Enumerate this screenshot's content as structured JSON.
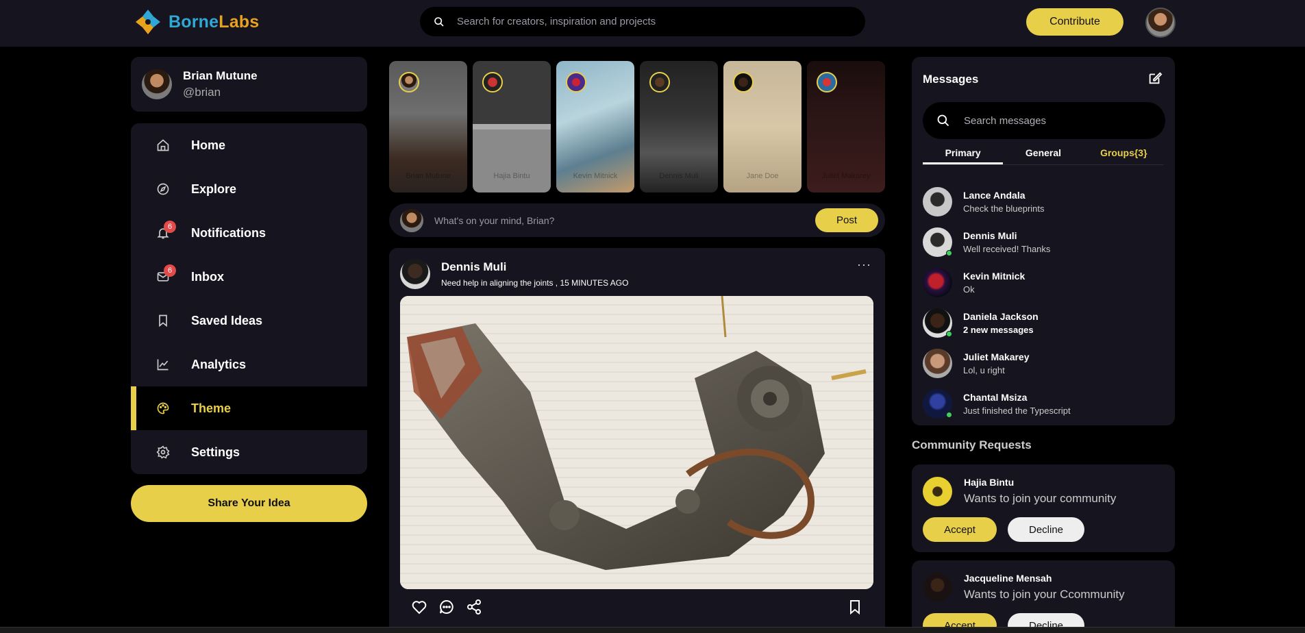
{
  "brand": {
    "part1": "Borne",
    "part2": "Labs"
  },
  "search": {
    "placeholder": "Search for creators, inspiration and projects"
  },
  "header": {
    "contribute_label": "Contribute"
  },
  "profile": {
    "name": "Brian Mutune",
    "handle": "@brian"
  },
  "nav": {
    "items": [
      {
        "label": "Home",
        "icon": "home-icon"
      },
      {
        "label": "Explore",
        "icon": "compass-icon"
      },
      {
        "label": "Notifications",
        "icon": "bell-icon",
        "badge": "6"
      },
      {
        "label": "Inbox",
        "icon": "mail-icon",
        "badge": "6"
      },
      {
        "label": "Saved Ideas",
        "icon": "bookmark-icon"
      },
      {
        "label": "Analytics",
        "icon": "chart-icon"
      },
      {
        "label": "Theme",
        "icon": "palette-icon",
        "active": true
      },
      {
        "label": "Settings",
        "icon": "gear-icon"
      }
    ],
    "share_label": "Share Your Idea"
  },
  "stories": [
    {
      "label": "Brian Mutune"
    },
    {
      "label": "Hajia Bintu"
    },
    {
      "label": "Kevin Mitnick"
    },
    {
      "label": "Dennis Muli"
    },
    {
      "label": "Jane Doe"
    },
    {
      "label": "Juliet Makarey"
    }
  ],
  "compose": {
    "placeholder": "What's on your mind, Brian?",
    "post_label": "Post"
  },
  "post": {
    "author": "Dennis Muli",
    "caption": "Need help in aligning the joints , 15 MINUTES AGO",
    "more": "···"
  },
  "messages": {
    "title": "Messages",
    "search_placeholder": "Search messages",
    "tabs": [
      "Primary",
      "General",
      "Groups{3}"
    ],
    "items": [
      {
        "name": "Lance Andala",
        "text": "Check the blueprints",
        "online": false
      },
      {
        "name": "Dennis Muli",
        "text": "Well received! Thanks",
        "online": true
      },
      {
        "name": "Kevin Mitnick",
        "text": "Ok",
        "online": false
      },
      {
        "name": "Daniela Jackson",
        "text": "2 new messages",
        "online": true,
        "bold": true
      },
      {
        "name": "Juliet Makarey",
        "text": "Lol, u right",
        "online": false
      },
      {
        "name": "Chantal Msiza",
        "text": "Just finished the Typescript",
        "online": true
      }
    ]
  },
  "community": {
    "title": "Community Requests",
    "requests": [
      {
        "name": "Hajia Bintu",
        "text": "Wants to join your community",
        "accept": "Accept",
        "decline": "Decline"
      },
      {
        "name": "Jacqueline Mensah",
        "text": "Wants to join your Ccommunity",
        "accept": "Accept",
        "decline": "Decline"
      }
    ]
  },
  "colors": {
    "accent": "#e8cf4a",
    "panel": "#16151f",
    "background": "#000000",
    "brand_blue": "#2fa8d6",
    "brand_orange": "#e8a21e"
  }
}
